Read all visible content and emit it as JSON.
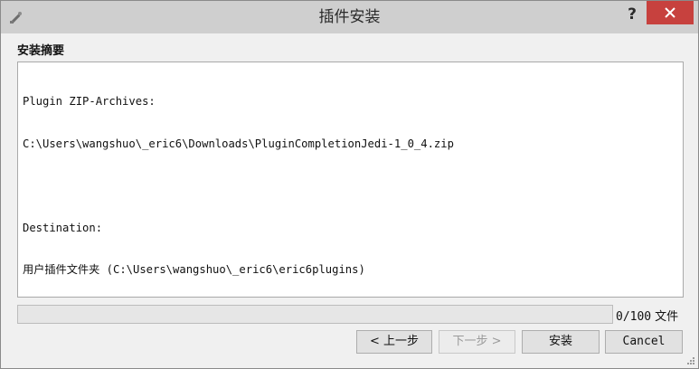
{
  "window": {
    "title": "插件安装",
    "help_label": "?"
  },
  "summary": {
    "heading": "安装摘要",
    "lines": [
      "Plugin ZIP-Archives:",
      "C:\\Users\\wangshuo\\_eric6\\Downloads\\PluginCompletionJedi-1_0_4.zip",
      "",
      "Destination:",
      "用户插件文件夹 (C:\\Users\\wangshuo\\_eric6\\eric6plugins)"
    ]
  },
  "progress": {
    "value": 0,
    "max": 100,
    "text": "0/100",
    "unit": "文件"
  },
  "buttons": {
    "prev": "< 上一步",
    "next": "下一步 >",
    "install": "安装",
    "cancel": "Cancel"
  },
  "colors": {
    "close_button": "#c7413e",
    "titlebar": "#cfcfcf",
    "progress_fill": "#06b025"
  },
  "icons": {
    "app": "plugin-wand-icon",
    "close": "close-icon",
    "grip": "resize-grip-icon"
  }
}
